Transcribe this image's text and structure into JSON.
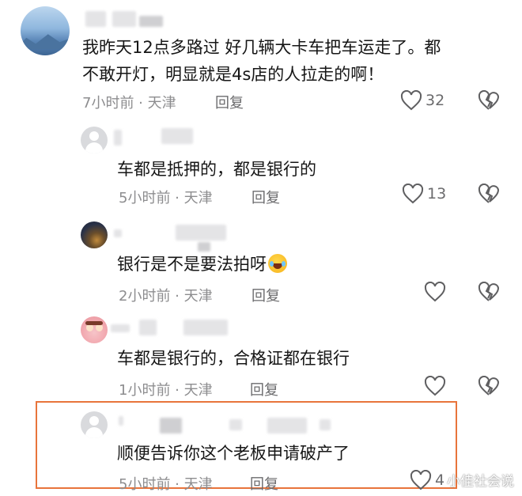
{
  "comments": [
    {
      "text_line1": "我昨天12点多路过 好几辆大卡车把车运走了。都",
      "text_line2": "不敢开灯，明显就是4s店的人拉走的啊！",
      "time": "7小时前 · 天津",
      "reply_label": "回复",
      "like_count": "32"
    },
    {
      "text": "车都是抵押的，都是银行的",
      "time": "5小时前 · 天津",
      "reply_label": "回复",
      "like_count": "13"
    },
    {
      "text": "银行是不是要法拍呀",
      "time": "2小时前 · 天津",
      "reply_label": "回复",
      "like_count": ""
    },
    {
      "text": "车都是银行的，合格证都在银行",
      "time": "1小时前 · 天津",
      "reply_label": "回复",
      "like_count": ""
    },
    {
      "text": "顺便告诉你这个老板申请破产了",
      "time": "5小时前 · 天津",
      "reply_label": "回复",
      "like_count": "4"
    }
  ],
  "watermark": "小佳社会说",
  "colors": {
    "highlight_border": "#e8743b",
    "meta_text": "#8d8d8f",
    "body_text": "#161616"
  },
  "icons": [
    "heart-icon",
    "dislike-broken-heart-icon",
    "laughing-tears-emoji"
  ]
}
